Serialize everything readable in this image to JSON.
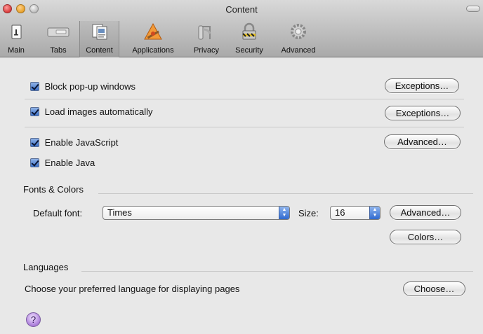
{
  "window": {
    "title": "Content"
  },
  "toolbar": {
    "items": [
      {
        "label": "Main",
        "icon": "main-icon"
      },
      {
        "label": "Tabs",
        "icon": "tabs-icon"
      },
      {
        "label": "Content",
        "icon": "content-icon",
        "active": true
      },
      {
        "label": "Applications",
        "icon": "applications-icon"
      },
      {
        "label": "Privacy",
        "icon": "privacy-icon"
      },
      {
        "label": "Security",
        "icon": "security-icon"
      },
      {
        "label": "Advanced",
        "icon": "advanced-icon"
      }
    ]
  },
  "content": {
    "block_popups": {
      "label": "Block pop-up windows",
      "checked": true,
      "button": "Exceptions…"
    },
    "load_images": {
      "label": "Load images automatically",
      "checked": true,
      "button": "Exceptions…"
    },
    "javascript": {
      "label": "Enable JavaScript",
      "checked": true,
      "button": "Advanced…"
    },
    "java": {
      "label": "Enable Java",
      "checked": true
    }
  },
  "fonts_colors": {
    "heading": "Fonts & Colors",
    "default_font_label": "Default font:",
    "default_font_value": "Times",
    "size_label": "Size:",
    "size_value": "16",
    "advanced_button": "Advanced…",
    "colors_button": "Colors…"
  },
  "languages": {
    "heading": "Languages",
    "description": "Choose your preferred language for displaying pages",
    "choose_button": "Choose…"
  },
  "help": {
    "symbol": "?"
  }
}
